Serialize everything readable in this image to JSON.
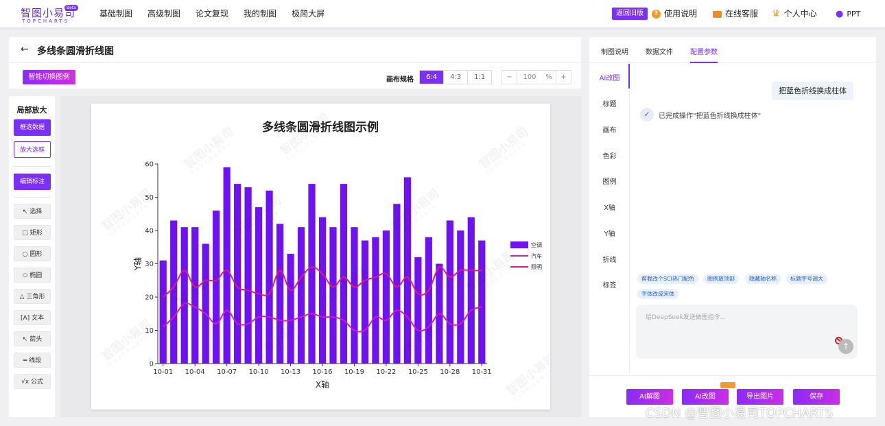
{
  "logo": {
    "name": "智图小易司",
    "sub": "TOPCHARTS",
    "badge": "Beta"
  },
  "nav": [
    "基础制图",
    "高级制图",
    "论文复现",
    "我的制图",
    "极简大屏"
  ],
  "top_right": {
    "old_version": "返回旧版",
    "help": "使用说明",
    "service": "在线客服",
    "profile": "个人中心",
    "ppt": "PPT"
  },
  "page": {
    "back": "←",
    "title": "多线条圆滑折线图"
  },
  "toolbar": {
    "smart_legend": "智能切换图例",
    "canvas_spec_label": "画布规格",
    "ratios": [
      "6:4",
      "4:3",
      "1:1"
    ],
    "ratio_active": 0,
    "zoom_minus": "−",
    "zoom_value": "100",
    "zoom_unit": "%",
    "zoom_plus": "+"
  },
  "tools": {
    "header": "局部放大",
    "select_data": "框选数据",
    "zoom_box": "放大选框",
    "edit_label": "编辑标注",
    "items": [
      {
        "icon": "↖",
        "label": "选择"
      },
      {
        "icon": "□",
        "label": "矩形"
      },
      {
        "icon": "○",
        "label": "圆形"
      },
      {
        "icon": "⬭",
        "label": "椭圆"
      },
      {
        "icon": "△",
        "label": "三角形"
      },
      {
        "icon": "[A]",
        "label": "文本"
      },
      {
        "icon": "↖",
        "label": "箭头"
      },
      {
        "icon": "═",
        "label": "线段"
      },
      {
        "icon": "√x",
        "label": "公式"
      }
    ]
  },
  "watermark": {
    "text": "智图小易司",
    "sub": "TOPCHARTS"
  },
  "chart_data": {
    "type": "bar",
    "title": "多线条圆滑折线图示例",
    "xlabel": "X轴",
    "ylabel": "Y轴",
    "ylim": [
      0,
      60
    ],
    "yticks": [
      0,
      10,
      20,
      30,
      40,
      50,
      60
    ],
    "categories": [
      "10-01",
      "10-02",
      "10-03",
      "10-04",
      "10-05",
      "10-06",
      "10-07",
      "10-08",
      "10-09",
      "10-10",
      "10-11",
      "10-12",
      "10-13",
      "10-14",
      "10-15",
      "10-16",
      "10-17",
      "10-18",
      "10-19",
      "10-20",
      "10-21",
      "10-22",
      "10-23",
      "10-24",
      "10-25",
      "10-26",
      "10-27",
      "10-28",
      "10-29",
      "10-30",
      "10-31"
    ],
    "xtick_labels": [
      "10-01",
      "10-04",
      "10-07",
      "10-10",
      "10-13",
      "10-16",
      "10-19",
      "10-22",
      "10-25",
      "10-28",
      "10-31"
    ],
    "series": [
      {
        "name": "空调",
        "kind": "bar",
        "color": "#6f12f2",
        "values": [
          31,
          43,
          41,
          41,
          36,
          46,
          59,
          54,
          53,
          47,
          52,
          42,
          33,
          41,
          54,
          44,
          41,
          54,
          41,
          37,
          38,
          40,
          48,
          56,
          32,
          38,
          30,
          43,
          40,
          44,
          37
        ]
      },
      {
        "name": "汽车",
        "kind": "line",
        "color": "#d619b7",
        "values": [
          11,
          14,
          18,
          17,
          15,
          12,
          16,
          12,
          12,
          14,
          14,
          13,
          13,
          14,
          15,
          14,
          14,
          13,
          10,
          10,
          14,
          13,
          16,
          14,
          10,
          11,
          15,
          12,
          12,
          16,
          17
        ]
      },
      {
        "name": "照明",
        "kind": "line",
        "color": "#e3187a",
        "values": [
          20,
          23,
          28,
          23,
          25,
          25,
          28,
          23,
          22,
          21,
          21,
          28,
          22,
          26,
          29,
          27,
          23,
          26,
          23,
          25,
          26,
          27,
          23,
          26,
          21,
          22,
          29,
          26,
          28,
          28,
          28
        ]
      }
    ],
    "legend": "right"
  },
  "right": {
    "tabs": [
      "制图说明",
      "数据文件",
      "配置参数"
    ],
    "active_tab": 2,
    "side": [
      "AI改图",
      "标题",
      "画布",
      "色彩",
      "图例",
      "X轴",
      "Y轴",
      "折线",
      "标签"
    ],
    "user_msg": "把蓝色折线换成柱体",
    "reply": "已完成操作\"把蓝色折线换成柱体\"",
    "chips": [
      "帮我改个SCI热门配色",
      "图例放顶部",
      "隐藏轴名称",
      "标题字号调大",
      "字体改成宋体"
    ],
    "input_placeholder": "给DeepSeek发送做图指令...",
    "send": "↑",
    "bottom_buttons": [
      "AI解图",
      "AI改图",
      "导出图片",
      "保存"
    ]
  },
  "footer_watermark": "CSDN @智图小易司TOPCHARTS"
}
